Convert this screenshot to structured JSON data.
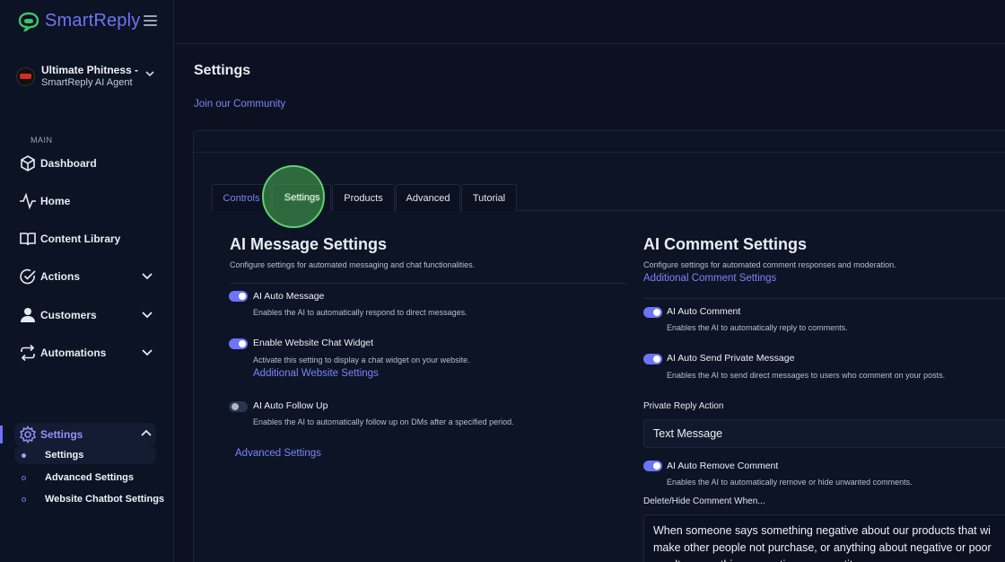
{
  "brand": {
    "name": "SmartReply"
  },
  "account": {
    "name": "Ultimate Phitness -",
    "subtitle": "SmartReply AI Agent"
  },
  "sidebar": {
    "section_label": "MAIN",
    "items": [
      {
        "label": "Dashboard",
        "icon": "cube-icon"
      },
      {
        "label": "Home",
        "icon": "activity-icon"
      },
      {
        "label": "Content Library",
        "icon": "book-icon"
      },
      {
        "label": "Actions",
        "icon": "check-circle-icon"
      },
      {
        "label": "Customers",
        "icon": "user-icon"
      },
      {
        "label": "Automations",
        "icon": "repeat-icon"
      },
      {
        "label": "Settings",
        "icon": "gear-icon"
      }
    ],
    "settings_sub": [
      {
        "label": "Settings"
      },
      {
        "label": "Advanced Settings"
      },
      {
        "label": "Website Chatbot Settings"
      }
    ]
  },
  "page": {
    "title": "Settings",
    "community_link": "Join our Community"
  },
  "tabs": [
    "Controls",
    "Settings",
    "Products",
    "Advanced",
    "Tutorial"
  ],
  "message_settings": {
    "title": "AI Message Settings",
    "description": "Configure settings for automated messaging and chat functionalities.",
    "options": [
      {
        "label": "AI Auto Message",
        "desc": "Enables the AI to automatically respond to direct messages.",
        "enabled": true
      },
      {
        "label": "Enable Website Chat Widget",
        "desc": "Activate this setting to display a chat widget on your website.",
        "link": "Additional Website Settings",
        "enabled": true
      },
      {
        "label": "AI Auto Follow Up",
        "desc": "Enables the AI to automatically follow up on DMs after a specified period.",
        "enabled": false
      }
    ],
    "advanced_link": "Advanced Settings"
  },
  "comment_settings": {
    "title": "AI Comment Settings",
    "description": "Configure settings for automated comment responses and moderation.",
    "link": "Additional Comment Settings",
    "options": [
      {
        "label": "AI Auto Comment",
        "desc": "Enables the AI to automatically reply to comments.",
        "enabled": true
      },
      {
        "label": "AI Auto Send Private Message",
        "desc": "Enables the AI to send direct messages to users who comment on your posts.",
        "enabled": true
      },
      {
        "label": "AI Auto Remove Comment",
        "desc": "Enables the AI to automatically remove or hide unwanted comments.",
        "enabled": true
      }
    ],
    "private_reply_label": "Private Reply Action",
    "private_reply_value": "Text Message",
    "delete_label": "Delete/Hide Comment When...",
    "delete_value": "When someone says something negative about our products that wi make other people not purchase, or anything about negative or poor results or anything promoting a competitor"
  },
  "colors": {
    "accent": "#6d74f5",
    "background": "#0b1120",
    "highlight": "#5fd16e"
  }
}
